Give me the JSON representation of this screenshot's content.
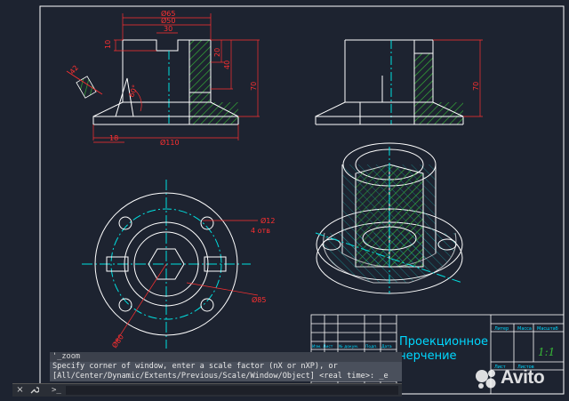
{
  "title_block": {
    "title_line1": "Проекционное",
    "title_line2": "черчение",
    "header_litera": "Литер",
    "header_massa": "Масса",
    "header_masshtab": "Масштаб",
    "scale_value": "1:1",
    "sheet_label": "Лист",
    "sheets_label": "Листов",
    "row_labels": [
      "Изм. Лист",
      "№ докум.",
      "Подп.",
      "Дата"
    ],
    "role_labels": [
      "Разраб.",
      "Провер."
    ]
  },
  "dimensions": {
    "d65": "Ø65",
    "d50": "Ø50",
    "d30": "30",
    "d10": "10",
    "d20": "20",
    "d40": "40",
    "d70_front": "70",
    "d70_side": "70",
    "d60": "60°",
    "d18": "18",
    "d110": "Ø110",
    "d12": "Ø12",
    "holes": "4 отв",
    "d85": "Ø85",
    "d80": "Ø80",
    "d42": "42"
  },
  "command_line": {
    "history": "'_zoom",
    "line1": "Specify corner of window, enter a scale factor (nX or nXP), or",
    "line2": "[All/Center/Dynamic/Extents/Previous/Scale/Window/Object] <real time>: _e",
    "input_value": "",
    "close_icon": "×",
    "settings_icon": "wrench",
    "prompt_icon": ">_"
  },
  "watermark": {
    "text": "Avito"
  },
  "colors": {
    "background": "#1d2330",
    "outline": "#ffffff",
    "dimension": "#ff3030",
    "hatch": "#37b837",
    "centerline": "#00e0e0",
    "title_text": "#00d8ff"
  }
}
